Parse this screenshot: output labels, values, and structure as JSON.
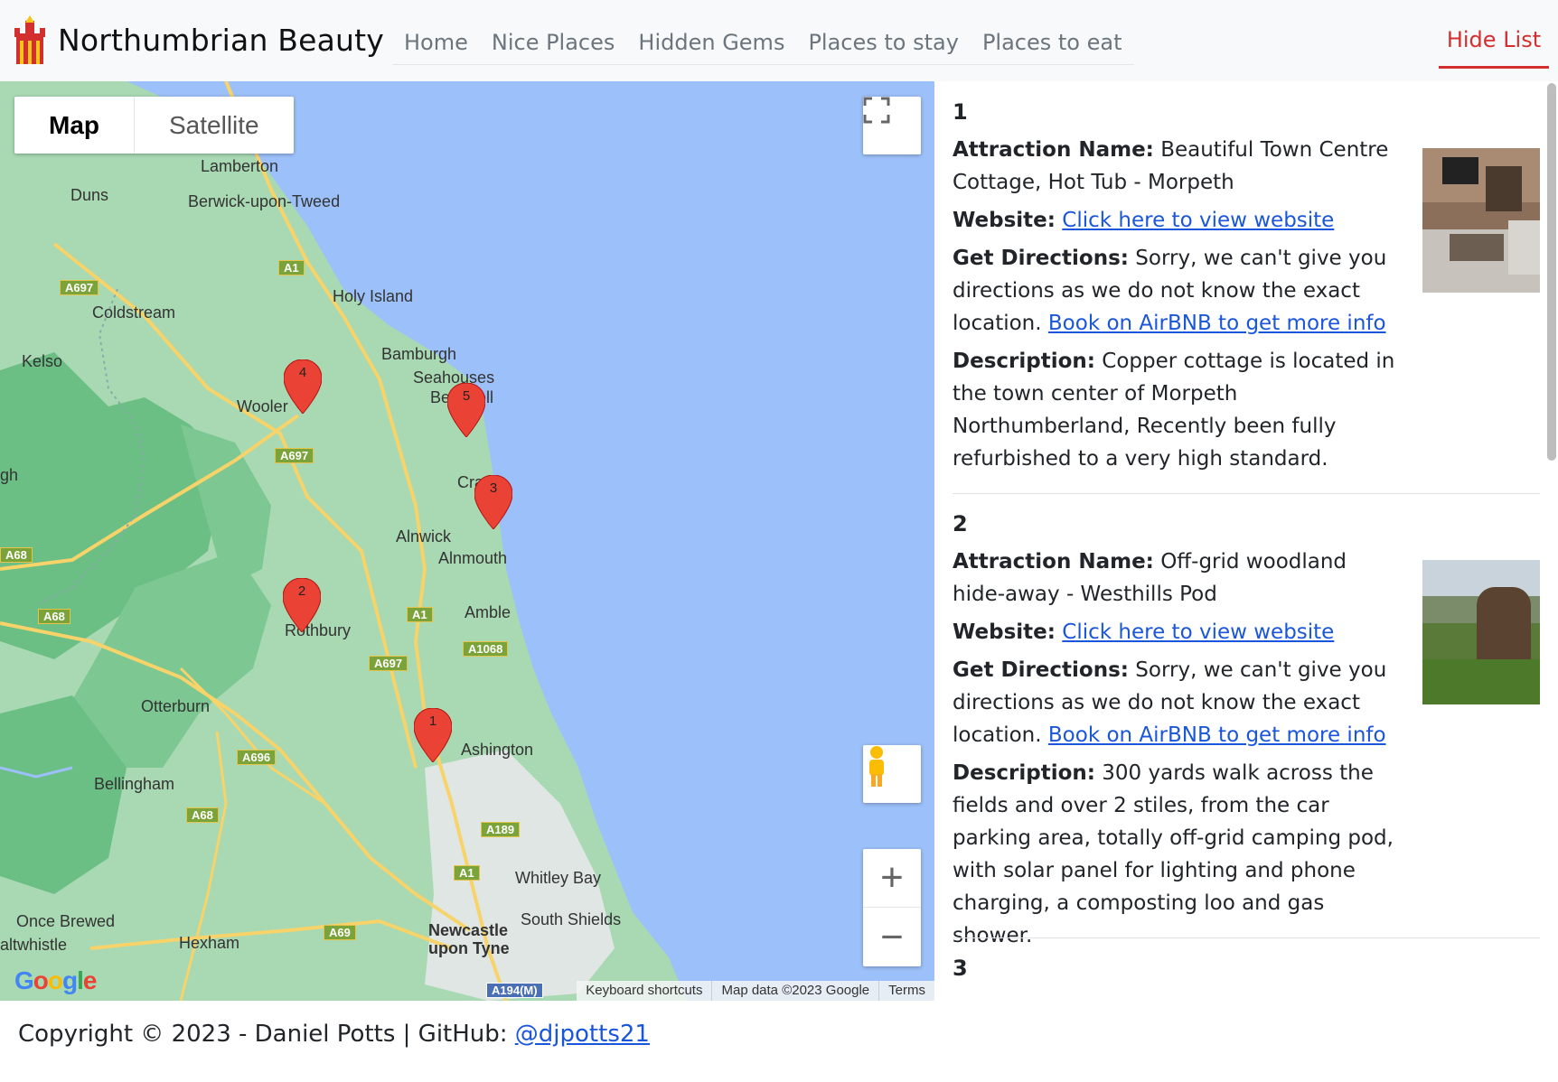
{
  "brand": {
    "name": "Northumbrian Beauty"
  },
  "nav": {
    "items": [
      "Home",
      "Nice Places",
      "Hidden Gems",
      "Places to stay",
      "Places to eat"
    ],
    "hide_list": "Hide List"
  },
  "map": {
    "type_map": "Map",
    "type_satellite": "Satellite",
    "zoom_in": "+",
    "zoom_out": "−",
    "footer": {
      "keyboard": "Keyboard shortcuts",
      "data": "Map data ©2023 Google",
      "terms": "Terms"
    },
    "google": "Google",
    "places": [
      "Lamberton",
      "Duns",
      "Berwick-upon-Tweed",
      "Holy Island",
      "Coldstream",
      "Kelso",
      "Bamburgh",
      "Seahouses",
      "Be",
      "ell",
      "Wooler",
      "gh",
      "Cra",
      "Alnwick",
      "Alnmouth",
      "Amble",
      "Rothbury",
      "Otterburn",
      "Ashington",
      "Bellingham",
      "Whitley Bay",
      "South Shields",
      "Once Brewed",
      "altwhistle",
      "Hexham",
      "Newcastle",
      "upon Tyne"
    ],
    "roads": [
      "A1",
      "A697",
      "A697",
      "A68",
      "A68",
      "A1",
      "A1068",
      "A697",
      "A696",
      "A68",
      "A189",
      "A1",
      "A69",
      "A194(M)"
    ],
    "markers": [
      "1",
      "2",
      "3",
      "4",
      "5"
    ]
  },
  "list": {
    "items": [
      {
        "num": "1",
        "name_label": "Attraction Name:",
        "name": "Beautiful Town Centre Cottage, Hot Tub - Morpeth",
        "website_label": "Website:",
        "website_link": "Click here to view website",
        "directions_label": "Get Directions:",
        "directions_text": "Sorry, we can't give you directions as we do not know the exact location.",
        "directions_link": "Book on AirBNB to get more info",
        "description_label": "Description:",
        "description": "Copper cottage is located in the town center of Morpeth Northumberland, Recently been fully refurbished to a very high standard."
      },
      {
        "num": "2",
        "name_label": "Attraction Name:",
        "name": "Off-grid woodland hide-away - Westhills Pod",
        "website_label": "Website:",
        "website_link": "Click here to view website",
        "directions_label": "Get Directions:",
        "directions_text": "Sorry, we can't give you directions as we do not know the exact location.",
        "directions_link": "Book on AirBNB to get more info",
        "description_label": "Description:",
        "description": "300 yards walk across the fields and over 2 stiles, from the car parking area, totally off-grid camping pod, with solar panel for lighting and phone charging, a composting loo and gas shower."
      },
      {
        "num": "3"
      }
    ]
  },
  "footer": {
    "text": "Copyright © 2023 - Daniel Potts | GitHub: ",
    "link": "@djpotts21"
  }
}
